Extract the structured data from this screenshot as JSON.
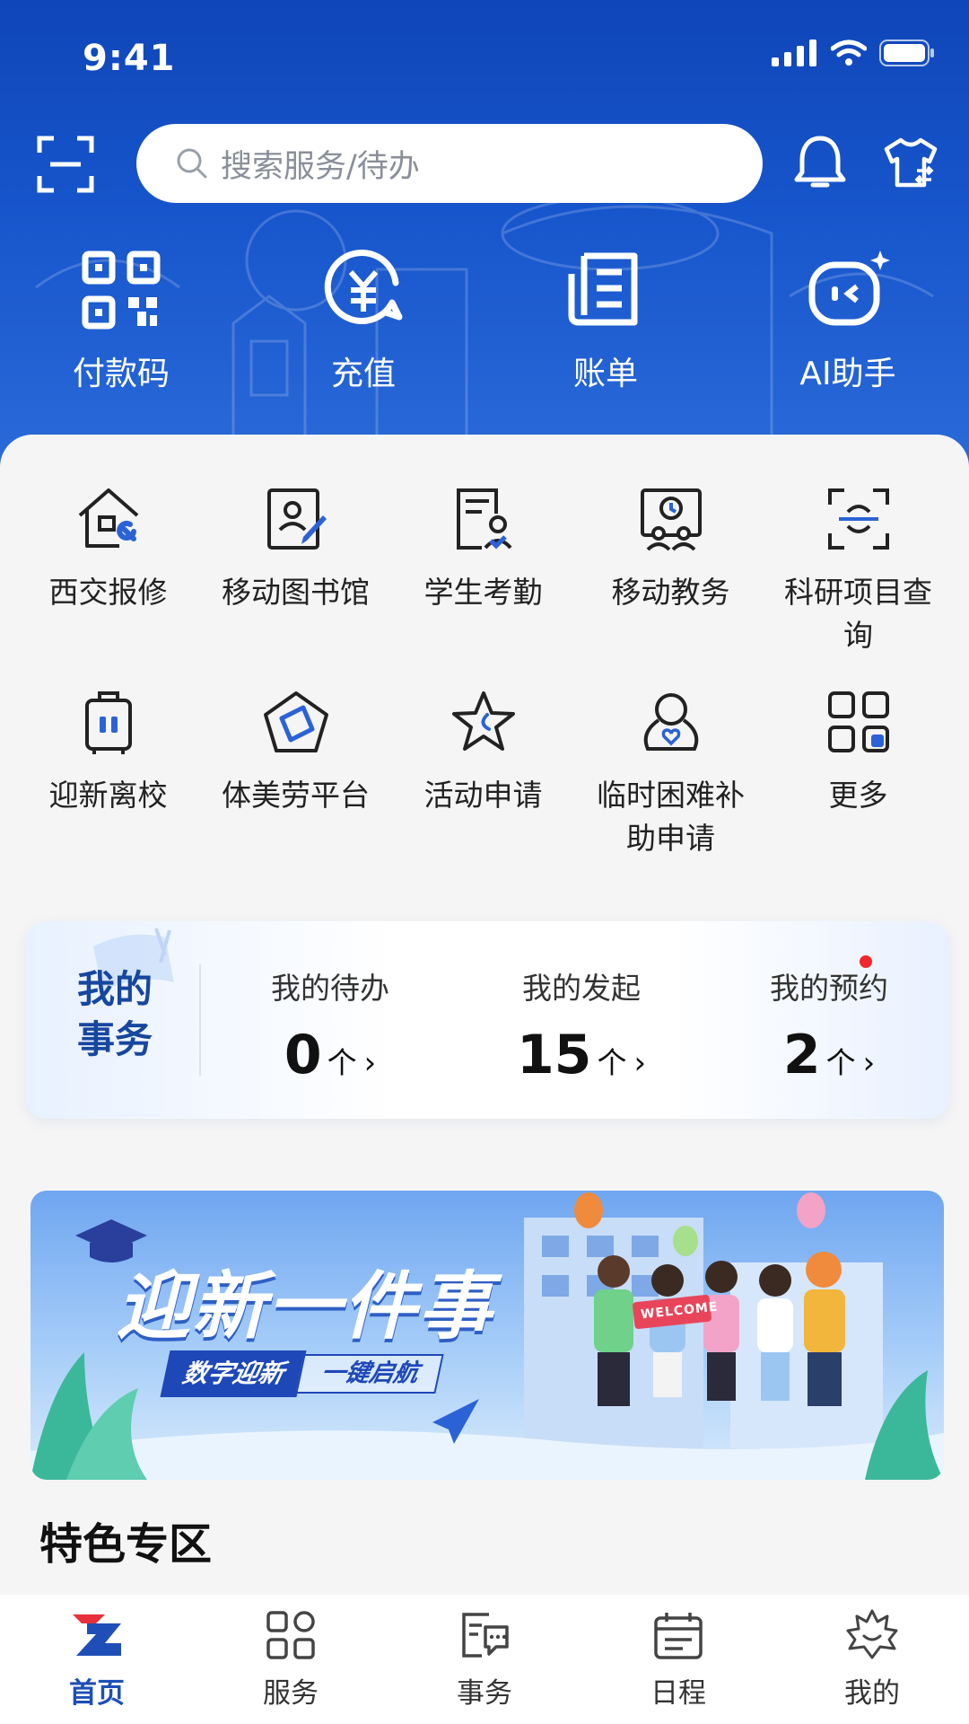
{
  "status_bar": {
    "time": "9:41"
  },
  "search": {
    "placeholder": "搜索服务/待办"
  },
  "quick_actions": [
    {
      "label": "付款码",
      "icon": "qr-code-icon"
    },
    {
      "label": "充值",
      "icon": "yuan-coin-icon"
    },
    {
      "label": "账单",
      "icon": "bill-icon"
    },
    {
      "label": "AI助手",
      "icon": "ai-assistant-icon"
    }
  ],
  "services_row1": [
    {
      "label": "西交报修",
      "icon": "house-repair-icon"
    },
    {
      "label": "移动图书馆",
      "icon": "library-icon"
    },
    {
      "label": "学生考勤",
      "icon": "attendance-icon"
    },
    {
      "label": "移动教务",
      "icon": "academic-affairs-icon"
    },
    {
      "label": "科研项目查询",
      "icon": "research-scan-icon"
    }
  ],
  "services_row2": [
    {
      "label": "迎新离校",
      "icon": "luggage-icon"
    },
    {
      "label": "体美劳平台",
      "icon": "pentagon-icon"
    },
    {
      "label": "活动申请",
      "icon": "star-icon"
    },
    {
      "label": "临时困难补助申请",
      "icon": "aid-person-icon"
    },
    {
      "label": "更多",
      "icon": "more-grid-icon"
    }
  ],
  "affairs": {
    "title_line1": "我的",
    "title_line2": "事务",
    "todo": {
      "label": "我的待办",
      "count": "0",
      "unit": "个"
    },
    "initiated": {
      "label": "我的发起",
      "count": "15",
      "unit": "个"
    },
    "booking": {
      "label": "我的预约",
      "count": "2",
      "unit": "个"
    },
    "arrow": "›"
  },
  "banner": {
    "title": "迎新一件事",
    "tag1": "数字迎新",
    "tag2": "一键启航",
    "sign": "WELCOME"
  },
  "section_title": "特色专区",
  "tabbar": [
    {
      "label": "首页",
      "icon": "home-logo-icon",
      "active": true
    },
    {
      "label": "服务",
      "icon": "services-grid-icon",
      "active": false
    },
    {
      "label": "事务",
      "icon": "affairs-chat-icon",
      "active": false
    },
    {
      "label": "日程",
      "icon": "calendar-icon",
      "active": false
    },
    {
      "label": "我的",
      "icon": "profile-leaf-icon",
      "active": false
    }
  ],
  "colors": {
    "hero": "#1755cc",
    "accent": "#1f4fb6",
    "badge": "#f0282d"
  }
}
